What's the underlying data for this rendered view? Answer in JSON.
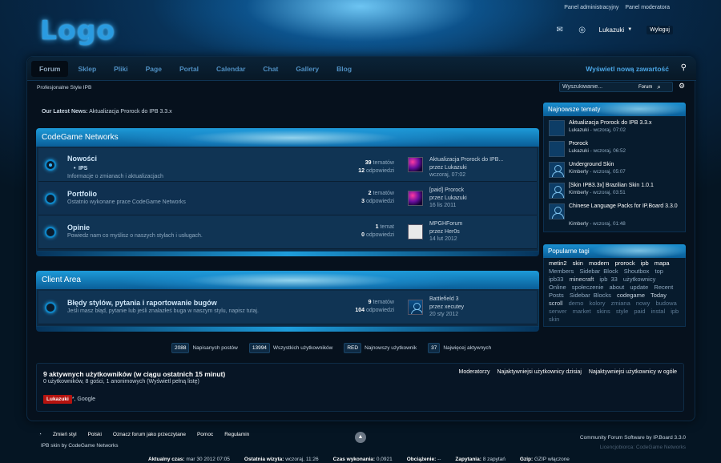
{
  "header": {
    "logo": "Logo",
    "admin_links": [
      "Panel administracyjny",
      "Panel moderatora"
    ],
    "user_name": "Lukazuki",
    "logout": "Wyloguj"
  },
  "nav": {
    "tabs": [
      "Forum",
      "Sklep",
      "Pliki",
      "Page",
      "Portal",
      "Calendar",
      "Chat",
      "Gallery",
      "Blog"
    ],
    "active": "Forum",
    "new_content": "Wyświetl nową zawartość"
  },
  "breadcrumb": "Profesjonalne Style IPB",
  "search": {
    "placeholder": "Wyszukiwanie...",
    "scope": "Forum"
  },
  "news": {
    "label": "Our Latest News:",
    "text": "Aktualizacja Prorock do IPB 3.3.x"
  },
  "categories": [
    {
      "title": "CodeGame Networks",
      "forums": [
        {
          "title": "Nowości",
          "subforum": "IPS",
          "desc": "Informacje o zmianach i aktualizacjach",
          "topics": "39",
          "topics_label": "tematów",
          "replies": "12",
          "replies_label": "odpowiedzi",
          "last_title": "Aktualizacja Prorock do IPB...",
          "last_by": "przez Lukazuki",
          "last_date": "wczoraj, 07:02"
        },
        {
          "title": "Portfolio",
          "desc": "Ostatnio wykonane prace CodeGame Networks",
          "topics": "2",
          "topics_label": "tematów",
          "replies": "3",
          "replies_label": "odpowiedzi",
          "last_title": "[paid] Prorock",
          "last_by": "przez Lukazuki",
          "last_date": "16 lis 2011"
        },
        {
          "title": "Opinie",
          "desc": "Powiedz nam co myślisz o naszych stylach i usługach.",
          "topics": "1",
          "topics_label": "temat",
          "replies": "0",
          "replies_label": "odpowiedzi",
          "last_title": "MPGHForum",
          "last_by": "przez Her0s",
          "last_date": "14 lut 2012"
        }
      ]
    },
    {
      "title": "Client Area",
      "forums": [
        {
          "title": "Błędy stylów, pytania i raportowanie bugów",
          "desc": "Jeśli masz błąd, pytanie lub jeśli znalazłeś buga w naszym stylu, napisz tutaj.",
          "topics": "9",
          "topics_label": "tematów",
          "replies": "104",
          "replies_label": "odpowiedzi",
          "last_title": "Battlefield 3",
          "last_by": "przez xecutey",
          "last_date": "20 sty 2012"
        }
      ]
    }
  ],
  "board_stats": [
    {
      "value": "2088",
      "label": "Napisanych postów"
    },
    {
      "value": "13994",
      "label": "Wszystkich użytkowników"
    },
    {
      "value": "RED",
      "label": "Najnowszy użytkownik"
    },
    {
      "value": "37",
      "label": "Najwięcej aktywnych"
    }
  ],
  "online": {
    "title": "9 aktywnych użytkowników (w ciągu ostatnich 15 minut)",
    "summary": "0 użytkowników, 8 gości, 1 anonimowych",
    "full_list": "(Wyświetl pełną listę)",
    "tabs": [
      "Moderatorzy",
      "Najaktywniejsi użytkownicy dzisiaj",
      "Najaktywniejsi użytkownicy w ogóle"
    ],
    "user": "Lukazuki",
    "bots": "*, Google"
  },
  "sidebar": {
    "latest_title": "Najnowsze tematy",
    "latest": [
      {
        "title": "Aktualizacja Prorock do IPB 3.3.x",
        "author": "Lukazuki",
        "when": " - wczoraj, 07:02",
        "avatar": "gfx"
      },
      {
        "title": "Prorock",
        "author": "Lukazuki",
        "when": " - wczoraj, 06:52",
        "avatar": "gfx"
      },
      {
        "title": "Underground Skin",
        "author": "Kimberly",
        "when": " - wczoraj, 05:07",
        "avatar": "person"
      },
      {
        "title": "[Skin IPB3.3x] Brazilian Skin 1.0.1",
        "author": "Kimberly",
        "when": " - wczoraj, 03:51",
        "avatar": "person"
      },
      {
        "title": "Chinese Language Packs for IP.Board 3.3.0",
        "author": "Kimberly",
        "when": " - wczoraj, 01:48",
        "avatar": "person"
      }
    ],
    "tags_title": "Popularne tagi",
    "tags": [
      {
        "t": "metin2",
        "c": "#ffffff"
      },
      {
        "t": "skin",
        "c": "#ffffff"
      },
      {
        "t": "modern",
        "c": "#ffffff"
      },
      {
        "t": "prorock",
        "c": "#ffffff"
      },
      {
        "t": "ipb",
        "c": "#ffffff"
      },
      {
        "t": "mapa",
        "c": "#ffffff"
      },
      {
        "t": "Members",
        "c": "#8fa9c0"
      },
      {
        "t": "Sidebar Block",
        "c": "#8fa9c0"
      },
      {
        "t": "Shoutbox",
        "c": "#8fa9c0"
      },
      {
        "t": "top",
        "c": "#8fa9c0"
      },
      {
        "t": "ipb33",
        "c": "#8fa9c0"
      },
      {
        "t": "minecraft",
        "c": "#c9d6e2"
      },
      {
        "t": "ipb 33",
        "c": "#8fa9c0"
      },
      {
        "t": "użytkownicy",
        "c": "#8fa9c0"
      },
      {
        "t": "Online",
        "c": "#8fa9c0"
      },
      {
        "t": "społeczenie",
        "c": "#8fa9c0"
      },
      {
        "t": "about",
        "c": "#8fa9c0"
      },
      {
        "t": "update",
        "c": "#8fa9c0"
      },
      {
        "t": "Recent Posts",
        "c": "#8fa9c0"
      },
      {
        "t": "Sidebar Blocks",
        "c": "#8fa9c0"
      },
      {
        "t": "codegame",
        "c": "#c9d6e2"
      },
      {
        "t": "Today",
        "c": "#c9d6e2"
      },
      {
        "t": "scroll",
        "c": "#c9d6e2"
      },
      {
        "t": "demo",
        "c": "#5e7b95"
      },
      {
        "t": "kolory",
        "c": "#5e7b95"
      },
      {
        "t": "zmiana",
        "c": "#5e7b95"
      },
      {
        "t": "nowy",
        "c": "#5e7b95"
      },
      {
        "t": "budowa",
        "c": "#5e7b95"
      },
      {
        "t": "serwer",
        "c": "#5e7b95"
      },
      {
        "t": "market",
        "c": "#5e7b95"
      },
      {
        "t": "skins",
        "c": "#5e7b95"
      },
      {
        "t": "style",
        "c": "#5e7b95"
      },
      {
        "t": "paid",
        "c": "#5e7b95"
      },
      {
        "t": "instal",
        "c": "#5e7b95"
      },
      {
        "t": "ipb skin",
        "c": "#5e7b95"
      }
    ]
  },
  "footer": {
    "links": [
      "Zmień styl",
      "Polski",
      "Oznacz forum jako przeczytane",
      "Pomoc",
      "Regulamin"
    ],
    "credit": "IPB skin by CodeGame Networks",
    "software": "Community Forum Software by IP.Board 3.3.0",
    "licensed": "Licencjobiorca: CodeGame Networks",
    "stats": [
      {
        "label": "Aktualny czas:",
        "value": "mar 30 2012 07:05"
      },
      {
        "label": "Ostatnia wizyta:",
        "value": "wczoraj, 11:26"
      },
      {
        "label": "Czas wykonania:",
        "value": "0,0921"
      },
      {
        "label": "Obciążenie:",
        "value": "--"
      },
      {
        "label": "Zapytania:",
        "value": "8 zapytań"
      },
      {
        "label": "Gzip:",
        "value": "GZIP włączone"
      }
    ]
  }
}
